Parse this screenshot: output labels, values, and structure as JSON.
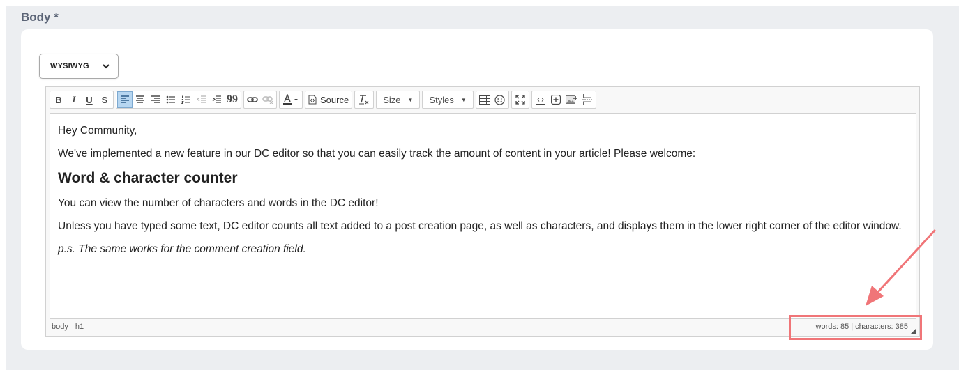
{
  "field": {
    "label": "Body *"
  },
  "mode_select": {
    "value": "WYSIWYG"
  },
  "toolbar": {
    "source_label": "Source",
    "size_label": "Size",
    "styles_label": "Styles"
  },
  "content": {
    "greeting": "Hey Community,",
    "intro": "We've implemented a new feature in our DC editor so that you can easily track the amount of content in your article! Please welcome:",
    "heading": "Word & character counter",
    "line1": "You can view the number of characters and words in the DC editor!",
    "line2": "Unless you have typed some text, DC editor counts all text added to a post creation page, as well as characters, and displays them in the lower right corner of the editor window.",
    "ps": "p.s. The same works for the comment creation field."
  },
  "status_bar": {
    "path": [
      "body",
      "h1"
    ],
    "counter": "words: 85 | characters: 385"
  },
  "colors": {
    "annotation": "#f07578",
    "active_button": "#b6d6f1"
  }
}
